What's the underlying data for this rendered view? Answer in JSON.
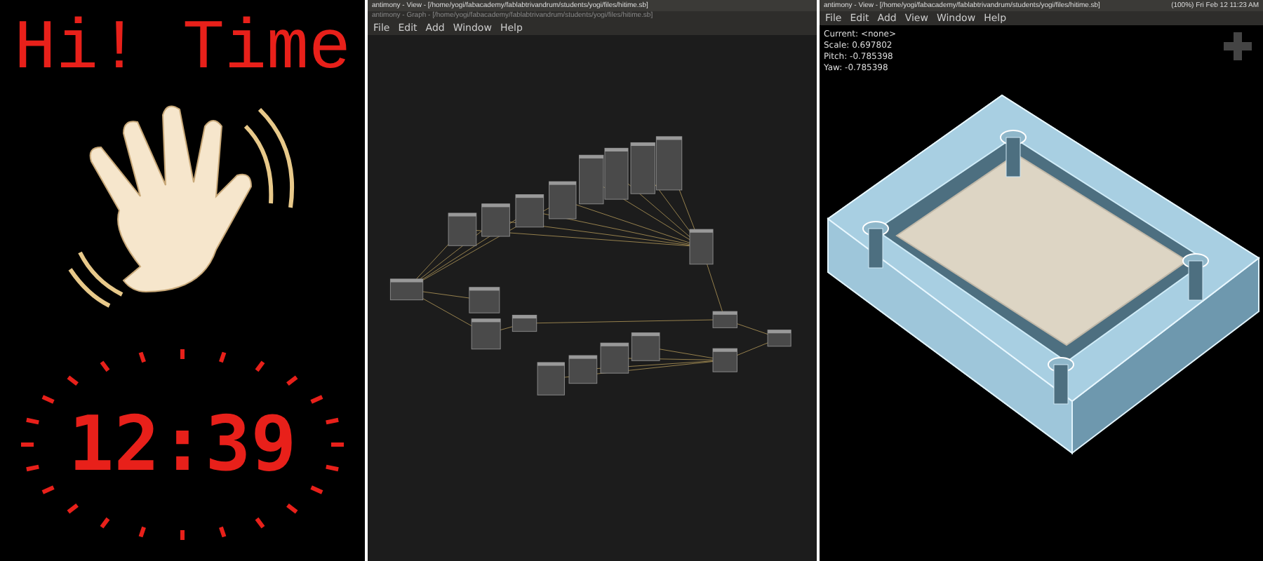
{
  "phone": {
    "title": "Hi! Time",
    "clock": "12:39"
  },
  "graph_window": {
    "title": "antimony - View - [/home/yogi/fabacademy/fablabtrivandrum/students/yogi/files/hitime.sb]",
    "subtitle": "antimony - Graph - [/home/yogi/fabacademy/fablabtrivandrum/students/yogi/files/hitime.sb]",
    "menu": [
      "File",
      "Edit",
      "Add",
      "Window",
      "Help"
    ]
  },
  "view_window": {
    "title": "antimony - View - [/home/yogi/fabacademy/fablabtrivandrum/students/yogi/files/hitime.sb]",
    "tray": "(100%)  Fri Feb 12 11:23 AM",
    "menu": [
      "File",
      "Edit",
      "Add",
      "View",
      "Window",
      "Help"
    ],
    "info": [
      "Current: <none>",
      "Scale: 0.697802",
      "Pitch: -0.785398",
      "Yaw: -0.785398"
    ]
  }
}
